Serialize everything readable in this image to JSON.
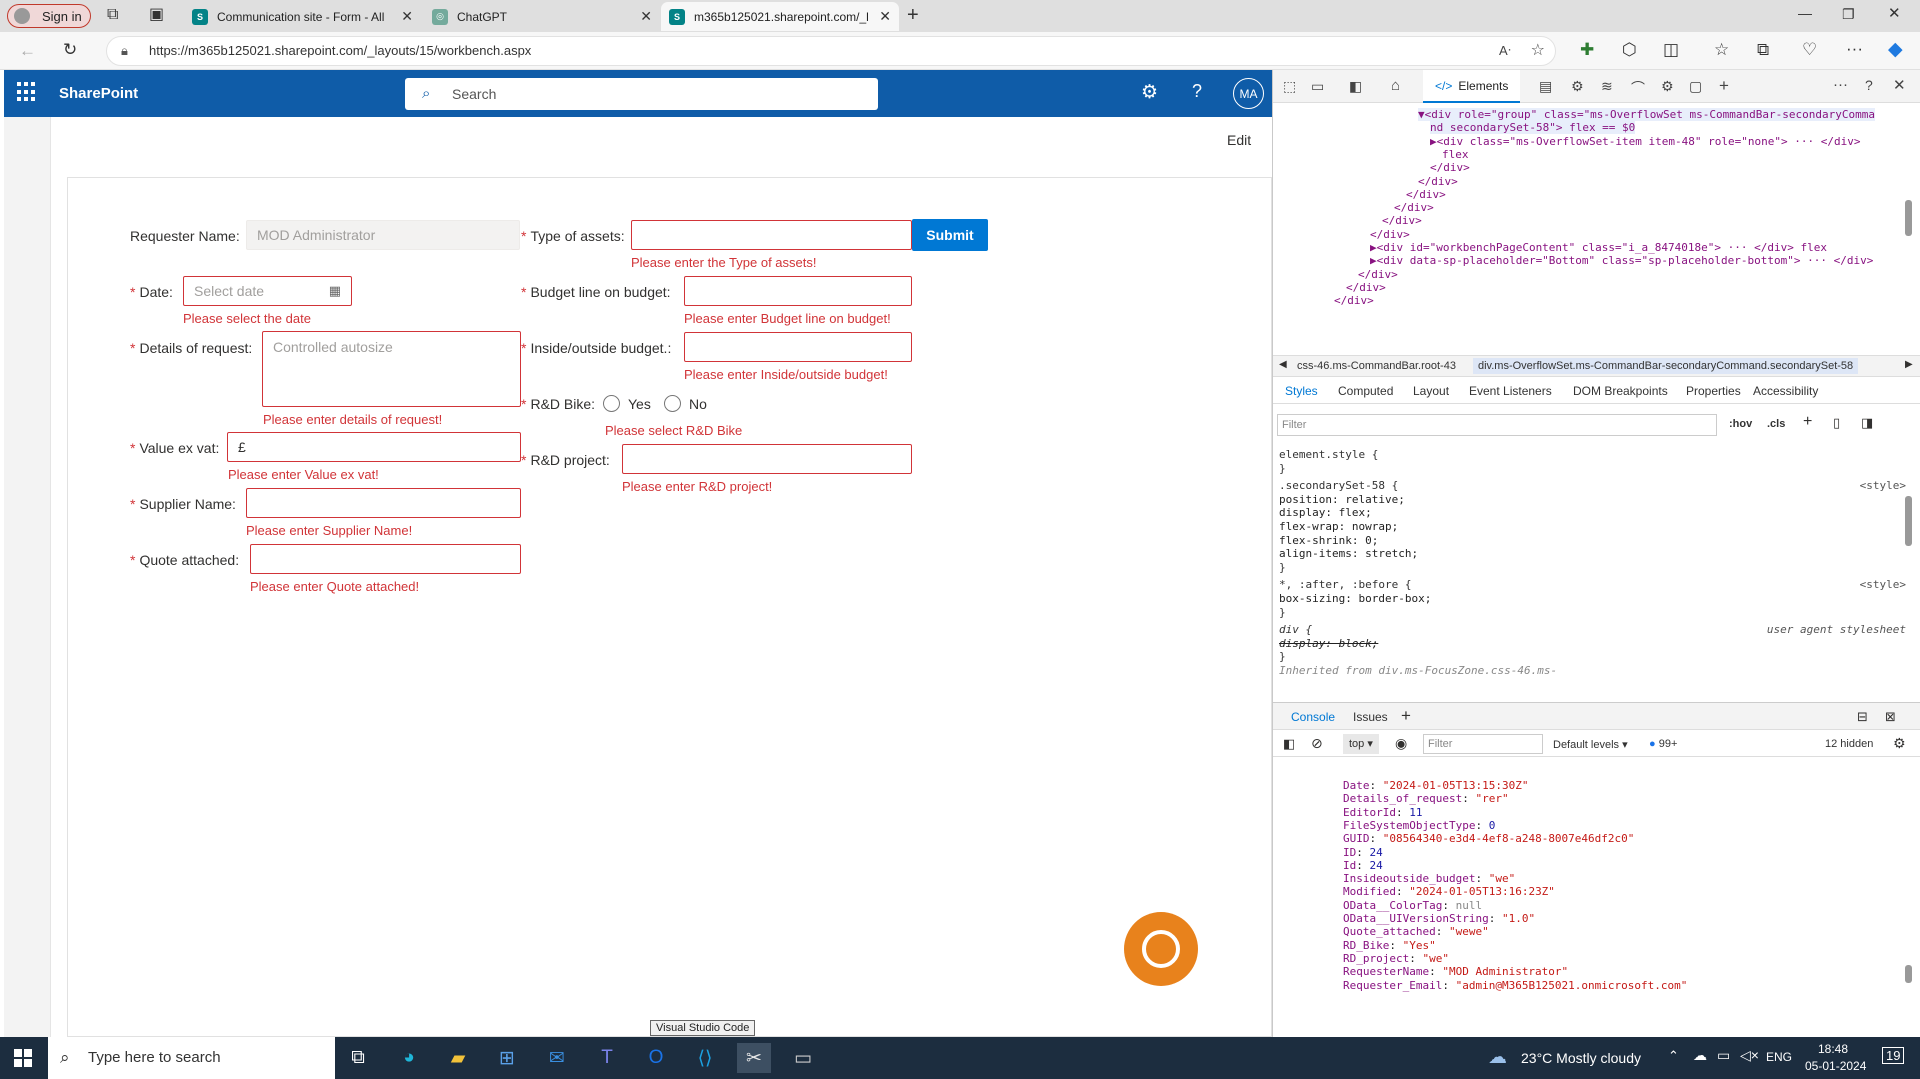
{
  "browser": {
    "signin_label": "Sign in",
    "tabs": [
      {
        "title": "Communication site - Form - All"
      },
      {
        "title": "ChatGPT"
      },
      {
        "title": "m365b125021.sharepoint.com/_l"
      }
    ],
    "url": "https://m365b125021.sharepoint.com/_layouts/15/workbench.aspx"
  },
  "sharepoint": {
    "title": "SharePoint",
    "search_placeholder": "Search",
    "avatar": "MA",
    "edit_label": "Edit"
  },
  "form": {
    "requester_label": "Requester Name:",
    "requester_value": "MOD Administrator",
    "date_label": "Date:",
    "date_placeholder": "Select date",
    "date_error": "Please select the date",
    "details_label": "Details of request:",
    "details_placeholder": "Controlled autosize",
    "details_error": "Please enter details of request!",
    "value_label": "Value ex vat:",
    "value_prefix": "£",
    "value_error": "Please enter Value ex vat!",
    "supplier_label": "Supplier Name:",
    "supplier_error": "Please enter Supplier Name!",
    "quote_label": "Quote attached:",
    "quote_error": "Please enter Quote attached!",
    "assets_label": "Type of assets:",
    "assets_error": "Please enter the Type of assets!",
    "submit_label": "Submit",
    "budget_label": "Budget line on budget:",
    "budget_error": "Please enter Budget line on budget!",
    "inside_label": "Inside/outside budget.:",
    "inside_error": "Please enter Inside/outside budget!",
    "rdbike_label": "R&D Bike:",
    "rdbike_yes": "Yes",
    "rdbike_no": "No",
    "rdbike_error": "Please select R&D Bike",
    "rdproject_label": "R&D project:",
    "rdproject_error": "Please enter R&D project!"
  },
  "tooltip": "Visual Studio Code",
  "devtools": {
    "elements_tab": "Elements",
    "dom_lines": [
      {
        "indent": 0,
        "text": "▼<div role=\"group\" class=\"ms-OverflowSet ms-CommandBar-secondaryComma"
      },
      {
        "indent": 1,
        "text": "nd secondarySet-58\"> flex == $0"
      },
      {
        "indent": 1,
        "text": "▶<div class=\"ms-OverflowSet-item item-48\" role=\"none\"> ··· </div>"
      },
      {
        "indent": 2,
        "text": "flex"
      },
      {
        "indent": 1,
        "text": "</div>"
      },
      {
        "indent": 0,
        "text": "</div>"
      },
      {
        "indent": -1,
        "text": "</div>"
      },
      {
        "indent": -2,
        "text": "</div>"
      },
      {
        "indent": -3,
        "text": "</div>"
      },
      {
        "indent": -4,
        "text": "</div>"
      },
      {
        "indent": -4,
        "text": "▶<div id=\"workbenchPageContent\" class=\"i_a_8474018e\"> ··· </div> flex"
      },
      {
        "indent": -4,
        "text": "▶<div data-sp-placeholder=\"Bottom\" class=\"sp-placeholder-bottom\"> ··· </div>"
      },
      {
        "indent": -5,
        "text": "</div>"
      },
      {
        "indent": -6,
        "text": "</div>"
      },
      {
        "indent": -7,
        "text": "</div>"
      }
    ],
    "breadcrumb": [
      "css-46.ms-CommandBar.root-43",
      "div.ms-OverflowSet.ms-CommandBar-secondaryCommand.secondarySet-58"
    ],
    "panel_tabs": [
      "Styles",
      "Computed",
      "Layout",
      "Event Listeners",
      "DOM Breakpoints",
      "Properties",
      "Accessibility"
    ],
    "filter_placeholder": "Filter",
    "hov": ":hov",
    "cls": ".cls",
    "styles": [
      {
        "text": "element.style {",
        "src": ""
      },
      {
        "text": "}",
        "src": ""
      },
      {
        "text": ".secondarySet-58 {",
        "src": "<style>"
      },
      {
        "text": "  position: relative;",
        "src": ""
      },
      {
        "text": "  display: flex;",
        "src": ""
      },
      {
        "text": "  flex-wrap: nowrap;",
        "src": ""
      },
      {
        "text": "  flex-shrink: 0;",
        "src": ""
      },
      {
        "text": "  align-items: stretch;",
        "src": ""
      },
      {
        "text": "}",
        "src": ""
      },
      {
        "text": "*, :after, :before {",
        "src": "<style>"
      },
      {
        "text": "  box-sizing: border-box;",
        "src": ""
      },
      {
        "text": "}",
        "src": ""
      },
      {
        "text": "div {",
        "src": "user agent stylesheet"
      },
      {
        "text": "  display: block;",
        "src": ""
      },
      {
        "text": "}",
        "src": ""
      },
      {
        "text": "Inherited from div.ms-FocusZone.css-46.ms-",
        "src": ""
      }
    ],
    "console_tabs": [
      "Console",
      "Issues"
    ],
    "context": "top",
    "console_filter": "Filter",
    "levels": "Default levels",
    "issues_count": "99+",
    "hidden": "12 hidden",
    "console_lines": [
      {
        "k": "Date",
        "v": "\"2024-01-05T13:15:30Z\""
      },
      {
        "k": "Details_of_request",
        "v": "\"rer\""
      },
      {
        "k": "EditorId",
        "v": "11"
      },
      {
        "k": "FileSystemObjectType",
        "v": "0"
      },
      {
        "k": "GUID",
        "v": "\"08564340-e3d4-4ef8-a248-8007e46df2c0\""
      },
      {
        "k": "ID",
        "v": "24"
      },
      {
        "k": "Id",
        "v": "24"
      },
      {
        "k": "Insideoutside_budget",
        "v": "\"we\""
      },
      {
        "k": "Modified",
        "v": "\"2024-01-05T13:16:23Z\""
      },
      {
        "k": "OData__ColorTag",
        "v": "null"
      },
      {
        "k": "OData__UIVersionString",
        "v": "\"1.0\""
      },
      {
        "k": "Quote_attached",
        "v": "\"wewe\""
      },
      {
        "k": "RD_Bike",
        "v": "\"Yes\""
      },
      {
        "k": "RD_project",
        "v": "\"we\""
      },
      {
        "k": "RequesterName",
        "v": "\"MOD Administrator\""
      },
      {
        "k": "Requester_Email",
        "v": "\"admin@M365B125021.onmicrosoft.com\""
      }
    ]
  },
  "taskbar": {
    "search_placeholder": "Type here to search",
    "weather": "23°C  Mostly cloudy",
    "lang": "ENG",
    "time": "18:48",
    "date": "05-01-2024",
    "notif": "19"
  },
  "colors": {
    "sp_blue": "#0f5ca8",
    "error_red": "#d13438",
    "accent_blue": "#0078d4",
    "bot_orange": "#e8821c"
  }
}
